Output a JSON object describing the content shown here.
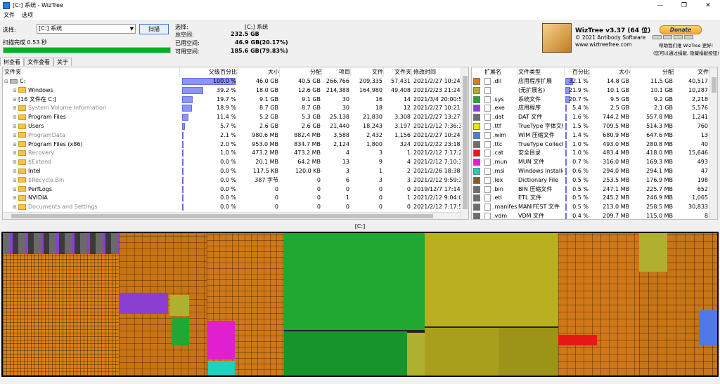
{
  "window": {
    "title": "[C:] 系统  - WizTree",
    "minimize": "—",
    "maximize": "❐",
    "close": "✕"
  },
  "menu": [
    "文件",
    "选项"
  ],
  "scan": {
    "select_label": "选择:",
    "drive_value": "[C:] 系统",
    "scan_button": "扫描",
    "scan_status": "扫描完成 0.53 秒",
    "progress": 1.0
  },
  "disk": {
    "select_label": "选择:",
    "select_value": "[C:]  系统",
    "total_label": "总空间:",
    "total_value": "232.5 GB",
    "used_label": "已用空间:",
    "used_value": "46.9 GB",
    "used_pct": "(20.17%)",
    "free_label": "可用空间:",
    "free_value": "185.6 GB",
    "free_pct": "(79.83%)"
  },
  "about": {
    "app_name": "WizTree v3.37 (64 位)",
    "copyright": "© 2021 Antibody Software",
    "website": "www.wiztreefree.com",
    "donate": "Donate",
    "help_text": "帮助我们维 WizTree 更好!",
    "donate_note": "(您可以通过捐献, 隐藏捐献按钮)"
  },
  "tabs": [
    "树查看",
    "文件查看",
    "关于"
  ],
  "tree": {
    "columns": [
      "文件夹",
      "父级百分比",
      "大小",
      "分配",
      "项目",
      "文件",
      "文件夹",
      "修改时间"
    ],
    "rows": [
      {
        "name": "C:",
        "pct": "100.0 %",
        "pct_value": 100,
        "size": "46.0 GB",
        "alloc": "40.5 GB",
        "items": "266,766",
        "files": "209,335",
        "folders": "57,431",
        "modified": "2021/2/27 10:24:02",
        "indent": 0,
        "gray": false,
        "icon": "drive"
      },
      {
        "name": "Windows",
        "pct": "39.2 %",
        "pct_value": 39.2,
        "size": "18.0 GB",
        "alloc": "12.6 GB",
        "items": "214,388",
        "files": "164,980",
        "folders": "49,408",
        "modified": "2021/2/23 21:24:16",
        "indent": 1,
        "gray": false,
        "icon": "folder"
      },
      {
        "name": "[16 文件在 C:]",
        "pct": "19.7 %",
        "pct_value": 19.7,
        "size": "9.1 GB",
        "alloc": "9.1 GB",
        "items": "30",
        "files": "16",
        "folders": "14",
        "modified": "2021/3/4 20:00:54",
        "indent": 1,
        "gray": false,
        "icon": "none"
      },
      {
        "name": "System Volume Information",
        "pct": "18.9 %",
        "pct_value": 18.9,
        "size": "8.7 GB",
        "alloc": "8.7 GB",
        "items": "30",
        "files": "18",
        "folders": "12",
        "modified": "2021/2/27 10:21:58",
        "indent": 1,
        "gray": true,
        "icon": "sys"
      },
      {
        "name": "Program Files",
        "pct": "11.4 %",
        "pct_value": 11.4,
        "size": "5.2 GB",
        "alloc": "5.3 GB",
        "items": "25,138",
        "files": "21,830",
        "folders": "3,308",
        "modified": "2021/2/27 13:27:30",
        "indent": 1,
        "gray": false,
        "icon": "folder"
      },
      {
        "name": "Users",
        "pct": "5.7 %",
        "pct_value": 5.7,
        "size": "2.6 GB",
        "alloc": "2.6 GB",
        "items": "21,440",
        "files": "18,243",
        "folders": "3,197",
        "modified": "2021/2/12 7:36:30",
        "indent": 1,
        "gray": false,
        "icon": "folder"
      },
      {
        "name": "ProgramData",
        "pct": "2.1 %",
        "pct_value": 2.1,
        "size": "980.6 MB",
        "alloc": "882.4 MB",
        "items": "3,588",
        "files": "2,432",
        "folders": "1,156",
        "modified": "2021/2/27 10:24:01",
        "indent": 1,
        "gray": true,
        "icon": "folder"
      },
      {
        "name": "Program Files (x86)",
        "pct": "2.0 %",
        "pct_value": 2.0,
        "size": "953.0 MB",
        "alloc": "834.7 MB",
        "items": "2,124",
        "files": "1,800",
        "folders": "324",
        "modified": "2021/2/22 23:18:33",
        "indent": 1,
        "gray": false,
        "icon": "folder"
      },
      {
        "name": "Recovery",
        "pct": "1.0 %",
        "pct_value": 1.0,
        "size": "473.2 MB",
        "alloc": "473.2 MB",
        "items": "4",
        "files": "3",
        "folders": "1",
        "modified": "2021/2/12 7:17:20",
        "indent": 1,
        "gray": true,
        "icon": "sys"
      },
      {
        "name": "$Extend",
        "pct": "0.0 %",
        "pct_value": 0,
        "size": "20.1 MB",
        "alloc": "64.2 MB",
        "items": "13",
        "files": "9",
        "folders": "4",
        "modified": "2021/2/12 7:10:30",
        "indent": 1,
        "gray": true,
        "icon": "sys"
      },
      {
        "name": "Intel",
        "pct": "0.0 %",
        "pct_value": 0,
        "size": "117.5 KB",
        "alloc": "120.0 KB",
        "items": "3",
        "files": "1",
        "folders": "2",
        "modified": "2021/2/26 18:38:35",
        "indent": 1,
        "gray": false,
        "icon": "folder"
      },
      {
        "name": "$Recycle.Bin",
        "pct": "0.0 %",
        "pct_value": 0,
        "size": "387 字节",
        "alloc": "0",
        "items": "6",
        "files": "3",
        "folders": "3",
        "modified": "2021/2/12 9:59:35",
        "indent": 1,
        "gray": true,
        "icon": "sys"
      },
      {
        "name": "PerfLogs",
        "pct": "0.0 %",
        "pct_value": 0,
        "size": "0",
        "alloc": "0",
        "items": "0",
        "files": "0",
        "folders": "0",
        "modified": "2019/12/7 17:14:52",
        "indent": 1,
        "gray": false,
        "icon": "folder"
      },
      {
        "name": "NVIDIA",
        "pct": "0.0 %",
        "pct_value": 0,
        "size": "0",
        "alloc": "0",
        "items": "1",
        "files": "0",
        "folders": "1",
        "modified": "2021/2/12 9:04:07",
        "indent": 1,
        "gray": false,
        "icon": "folder"
      },
      {
        "name": "Documents and Settings",
        "pct": "0.0 %",
        "pct_value": 0,
        "size": "0",
        "alloc": "0",
        "items": "0",
        "files": "0",
        "folders": "0",
        "modified": "2021/2/12 7:17:56",
        "indent": 1,
        "gray": true,
        "icon": "sys"
      }
    ]
  },
  "types": {
    "columns": [
      "扩展名",
      "文件类型",
      "百分比",
      "大小",
      "分配",
      "文件"
    ],
    "rows": [
      {
        "color": "#e07b1a",
        "ext": ".dll",
        "type": "应用程序扩展",
        "pct": "32.1 %",
        "pct_value": 32.1,
        "size": "14.8 GB",
        "alloc": "11.5 GB",
        "files": "40,517"
      },
      {
        "color": "#b0b030",
        "ext": "",
        "type": "(无扩展名)",
        "pct": "21.9 %",
        "pct_value": 21.9,
        "size": "10.1 GB",
        "alloc": "10.1 GB",
        "files": "10,287"
      },
      {
        "color": "#1fa832",
        "ext": ".sys",
        "type": "系统文件",
        "pct": "20.7 %",
        "pct_value": 20.7,
        "size": "9.5 GB",
        "alloc": "9.2 GB",
        "files": "2,218"
      },
      {
        "color": "#8a3fd0",
        "ext": ".exe",
        "type": "应用程序",
        "pct": "5.4 %",
        "pct_value": 5.4,
        "size": "2.5 GB",
        "alloc": "2.1 GB",
        "files": "5,576"
      },
      {
        "color": "#6d6d6d",
        "ext": ".dat",
        "type": "DAT 文件",
        "pct": "1.6 %",
        "pct_value": 1.6,
        "size": "744.2 MB",
        "alloc": "557.8 MB",
        "files": "1,241"
      },
      {
        "color": "#e8e800",
        "ext": ".ttf",
        "type": "TrueType 字体文件",
        "pct": "1.5 %",
        "pct_value": 1.5,
        "size": "709.5 MB",
        "alloc": "514.3 MB",
        "files": "760"
      },
      {
        "color": "#5078e8",
        "ext": ".wim",
        "type": "WIM 压缩文件",
        "pct": "1.4 %",
        "pct_value": 1.4,
        "size": "680.9 MB",
        "alloc": "647.6 MB",
        "files": "13"
      },
      {
        "color": "#6d6d6d",
        "ext": ".ttc",
        "type": "TrueType Collectio",
        "pct": "1.0 %",
        "pct_value": 1.0,
        "size": "493.0 MB",
        "alloc": "280.8 MB",
        "files": "40"
      },
      {
        "color": "#e81818",
        "ext": ".cat",
        "type": "安全目录",
        "pct": "1.0 %",
        "pct_value": 1.0,
        "size": "483.4 MB",
        "alloc": "418.0 MB",
        "files": "15,646"
      },
      {
        "color": "#e020d0",
        "ext": ".mun",
        "type": "MUN 文件",
        "pct": "0.7 %",
        "pct_value": 0.7,
        "size": "316.0 MB",
        "alloc": "169.3 MB",
        "files": "493"
      },
      {
        "color": "#20d0c0",
        "ext": ".msi",
        "type": "Windows Installer I",
        "pct": "0.6 %",
        "pct_value": 0.6,
        "size": "294.0 MB",
        "alloc": "294.1 MB",
        "files": "47"
      },
      {
        "color": "#8a5a2a",
        "ext": ".lex",
        "type": "Dictionary File",
        "pct": "0.5 %",
        "pct_value": 0.5,
        "size": "253.5 MB",
        "alloc": "176.9 MB",
        "files": "198"
      },
      {
        "color": "#6d6d6d",
        "ext": ".bin",
        "type": "BIN 压缩文件",
        "pct": "0.5 %",
        "pct_value": 0.5,
        "size": "247.1 MB",
        "alloc": "225.7 MB",
        "files": "652"
      },
      {
        "color": "#6d6d6d",
        "ext": ".etl",
        "type": "ETL 文件",
        "pct": "0.5 %",
        "pct_value": 0.5,
        "size": "245.2 MB",
        "alloc": "246.9 MB",
        "files": "1,065"
      },
      {
        "color": "#6d6d6d",
        "ext": ".manifes",
        "type": "MANIFEST 文件",
        "pct": "0.5 %",
        "pct_value": 0.5,
        "size": "213.0 MB",
        "alloc": "258.5 MB",
        "files": "30,833"
      },
      {
        "color": "#6d6d6d",
        "ext": ".vdm",
        "type": "VDM 文件",
        "pct": "0.4 %",
        "pct_value": 0.4,
        "size": "209.7 MB",
        "alloc": "115.0 MB",
        "files": "8"
      }
    ]
  },
  "treemap": {
    "label": "[C:]"
  }
}
